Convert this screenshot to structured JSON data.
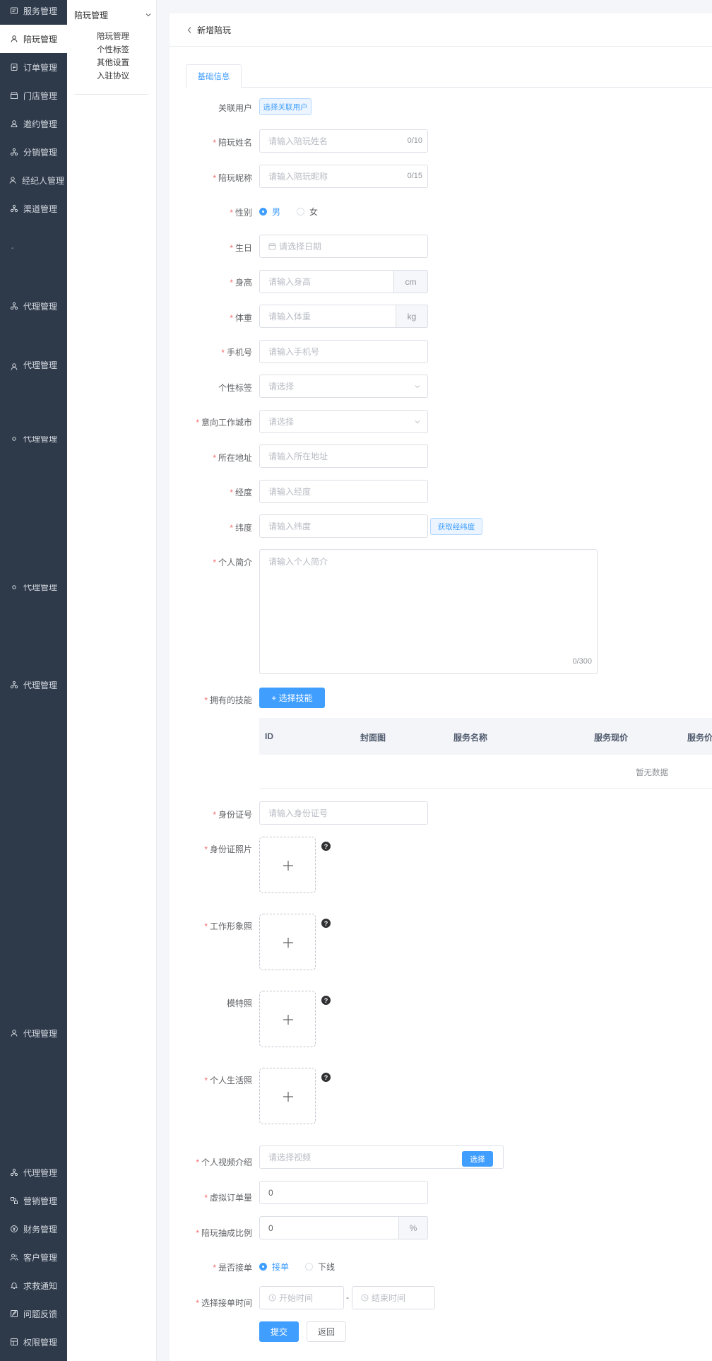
{
  "sidebar": {
    "items": [
      {
        "label": "服务管理",
        "icon": "service-icon",
        "active": false
      },
      {
        "label": "陪玩管理",
        "icon": "companion-icon",
        "active": true
      },
      {
        "label": "订单管理",
        "icon": "order-icon",
        "active": false
      },
      {
        "label": "门店管理",
        "icon": "store-icon",
        "active": false
      },
      {
        "label": "邀约管理",
        "icon": "invite-icon",
        "active": false
      },
      {
        "label": "分销管理",
        "icon": "distribution-icon",
        "active": false
      },
      {
        "label": "经纪人管理",
        "icon": "agent-icon",
        "active": false
      },
      {
        "label": "渠道管理",
        "icon": "channel-icon",
        "active": false
      },
      {
        "label": "-",
        "icon": "",
        "active": false
      },
      {
        "label": "代理管理",
        "icon": "proxy-icon",
        "active": false
      },
      {
        "label": "代理管理",
        "icon": "proxy-icon",
        "active": false
      },
      {
        "label": "代理管理",
        "icon": "proxy-icon",
        "active": false
      },
      {
        "label": "代理管理",
        "icon": "proxy-icon",
        "active": false
      },
      {
        "label": "代理管理",
        "icon": "proxy-icon",
        "active": false
      },
      {
        "label": "代理管理",
        "icon": "proxy-icon",
        "active": false
      },
      {
        "label": "代理管理",
        "icon": "proxy-icon",
        "active": false
      },
      {
        "label": "营销管理",
        "icon": "marketing-icon",
        "active": false
      },
      {
        "label": "财务管理",
        "icon": "finance-icon",
        "active": false
      },
      {
        "label": "客户管理",
        "icon": "customer-icon",
        "active": false
      },
      {
        "label": "求救通知",
        "icon": "bell-icon",
        "active": false
      },
      {
        "label": "问题反馈",
        "icon": "feedback-icon",
        "active": false
      },
      {
        "label": "权限管理",
        "icon": "permission-icon",
        "active": false
      }
    ]
  },
  "submenu": {
    "title": "陪玩管理",
    "items": [
      "陪玩管理",
      "个性标签",
      "其他设置",
      "入驻协议"
    ]
  },
  "header": {
    "back_label": "新增陪玩"
  },
  "tabs": [
    "基础信息"
  ],
  "form": {
    "linked_user": {
      "label": "关联用户",
      "button": "选择关联用户"
    },
    "name": {
      "label": "陪玩姓名",
      "placeholder": "请输入陪玩姓名",
      "counter": "0/10"
    },
    "nickname": {
      "label": "陪玩昵称",
      "placeholder": "请输入陪玩昵称",
      "counter": "0/15"
    },
    "gender": {
      "label": "性别",
      "options": [
        "男",
        "女"
      ],
      "selected": "男"
    },
    "birthday": {
      "label": "生日",
      "placeholder": "请选择日期"
    },
    "height": {
      "label": "身高",
      "placeholder": "请输入身高",
      "unit": "cm"
    },
    "weight": {
      "label": "体重",
      "placeholder": "请输入体重",
      "unit": "kg"
    },
    "phone": {
      "label": "手机号",
      "placeholder": "请输入手机号"
    },
    "tags": {
      "label": "个性标签",
      "placeholder": "请选择"
    },
    "city": {
      "label": "意向工作城市",
      "placeholder": "请选择"
    },
    "address": {
      "label": "所在地址",
      "placeholder": "请输入所在地址"
    },
    "longitude": {
      "label": "经度",
      "placeholder": "请输入经度"
    },
    "latitude": {
      "label": "纬度",
      "placeholder": "请输入纬度",
      "button": "获取经纬度"
    },
    "intro": {
      "label": "个人简介",
      "placeholder": "请输入个人简介",
      "counter": "0/300"
    },
    "skills": {
      "label": "拥有的技能",
      "button": "+ 选择技能",
      "columns": [
        "ID",
        "封面图",
        "服务名称",
        "服务现价",
        "服务价"
      ],
      "empty": "暂无数据"
    },
    "id_number": {
      "label": "身份证号",
      "placeholder": "请输入身份证号"
    },
    "id_photo": {
      "label": "身份证照片"
    },
    "work_photo": {
      "label": "工作形象照"
    },
    "model_photo": {
      "label": "模特照"
    },
    "life_photo": {
      "label": "个人生活照"
    },
    "video": {
      "label": "个人视频介绍",
      "placeholder": "请选择视频",
      "button": "选择"
    },
    "virtual_orders": {
      "label": "虚拟订单量",
      "value": "0"
    },
    "commission": {
      "label": "陪玩抽成比例",
      "value": "0",
      "unit": "%"
    },
    "accept": {
      "label": "是否接单",
      "options": [
        "接单",
        "下线"
      ],
      "selected": "接单"
    },
    "accept_time": {
      "label": "选择接单时间",
      "start_placeholder": "开始时间",
      "separator": "-",
      "end_placeholder": "结束时间"
    },
    "submit_label": "提交",
    "back_label": "返回"
  },
  "colors": {
    "primary": "#409eff",
    "sidebar_bg": "#2e3a4a",
    "required": "#f56c6c"
  }
}
